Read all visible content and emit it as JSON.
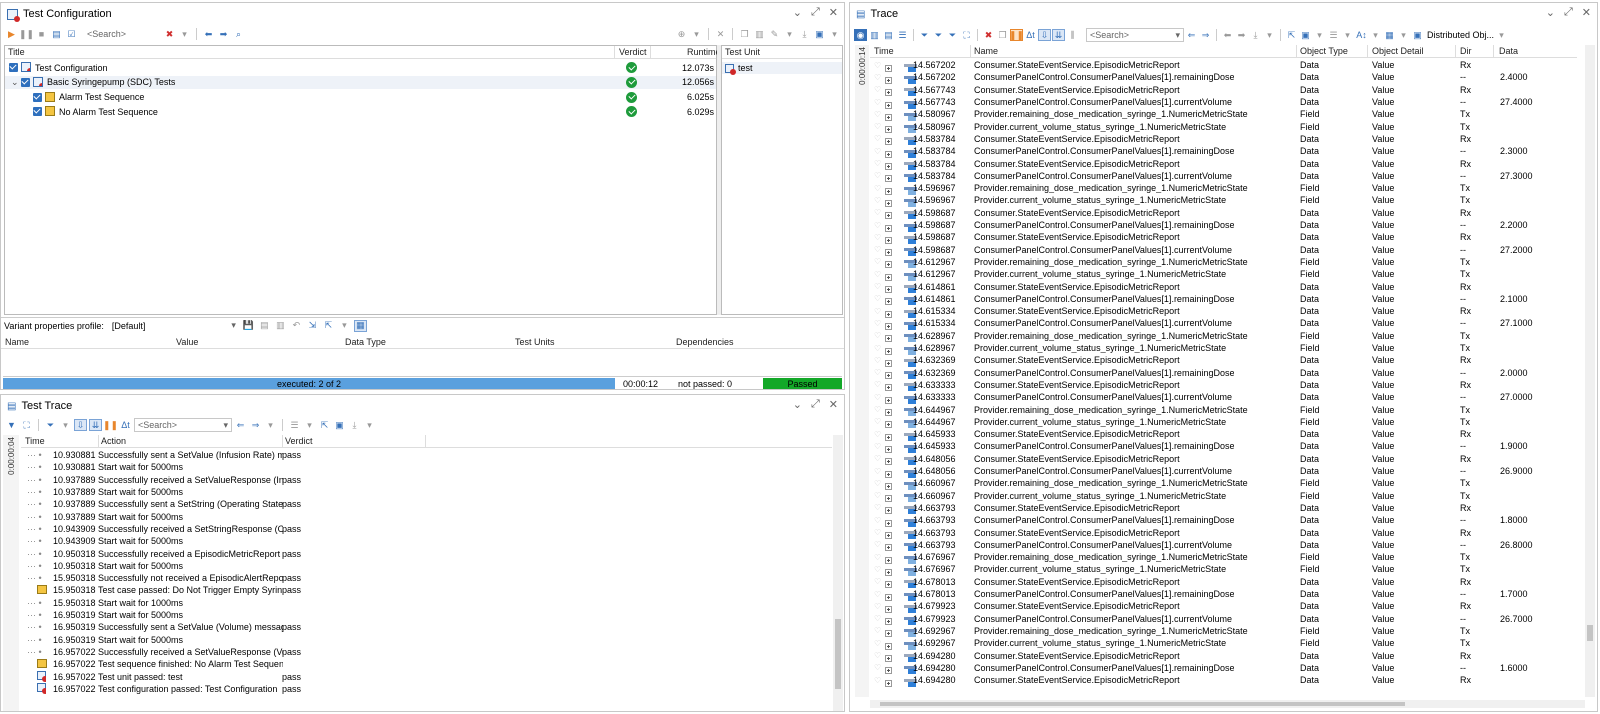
{
  "test_config": {
    "title": "Test Configuration",
    "search_placeholder": "<Search>",
    "columns": {
      "title": "Title",
      "verdict": "Verdict",
      "runtime": "Runtime",
      "test_unit": "Test Unit"
    },
    "rows": [
      {
        "label": "Test Configuration",
        "runtime": "12.073s",
        "level": 0
      },
      {
        "label": "Basic Syringepump (SDC) Tests",
        "runtime": "12.056s",
        "level": 1
      },
      {
        "label": "Alarm Test Sequence",
        "runtime": "6.025s",
        "level": 2
      },
      {
        "label": "No Alarm Test Sequence",
        "runtime": "6.029s",
        "level": 2
      }
    ],
    "test_unit_item": "test",
    "variant_label": "Variant properties profile:",
    "variant_value": "[Default]",
    "variant_columns": {
      "name": "Name",
      "value": "Value",
      "data_type": "Data Type",
      "test_units": "Test Units",
      "dependencies": "Dependencies"
    },
    "status": {
      "executed": "executed: 2 of 2",
      "elapsed": "00:00:12",
      "not_passed": "not passed: 0",
      "result": "Passed",
      "progress": 1.0
    }
  },
  "test_trace": {
    "title": "Test Trace",
    "search_placeholder": "<Search>",
    "time_gutter": "0:00:00:04",
    "columns": {
      "time": "Time",
      "action": "Action",
      "verdict": "Verdict"
    },
    "rows": [
      {
        "time": "10.930881",
        "action": "Successfully sent a SetValue (Infusion Rate) m...",
        "verdict": "pass"
      },
      {
        "time": "10.930881",
        "action": "Start wait for 5000ms",
        "verdict": ""
      },
      {
        "time": "10.937889",
        "action": "Successfully received a SetValueResponse (Inf...",
        "verdict": "pass"
      },
      {
        "time": "10.937889",
        "action": "Start wait for 5000ms",
        "verdict": ""
      },
      {
        "time": "10.937889",
        "action": "Successfully sent a SetString (Operating State)...",
        "verdict": "pass"
      },
      {
        "time": "10.937889",
        "action": "Start wait for 5000ms",
        "verdict": ""
      },
      {
        "time": "10.943909",
        "action": "Successfully received a SetStringResponse (Op...",
        "verdict": "pass"
      },
      {
        "time": "10.943909",
        "action": "Start wait for 5000ms",
        "verdict": ""
      },
      {
        "time": "10.950318",
        "action": "Successfully received a EpisodicMetricReport ...",
        "verdict": "pass"
      },
      {
        "time": "10.950318",
        "action": "Start wait for 5000ms",
        "verdict": ""
      },
      {
        "time": "15.950318",
        "action": "Successfully not received a EpisodicAlertRepor...",
        "verdict": "pass"
      },
      {
        "time": "15.950318",
        "action": "Test case passed: Do Not Trigger Empty Syrin...",
        "verdict": "pass"
      },
      {
        "time": "15.950318",
        "action": "Start wait for 1000ms",
        "verdict": ""
      },
      {
        "time": "16.950319",
        "action": "Start wait for 5000ms",
        "verdict": ""
      },
      {
        "time": "16.950319",
        "action": "Successfully sent a SetValue (Volume) messag...",
        "verdict": "pass"
      },
      {
        "time": "16.950319",
        "action": "Start wait for 5000ms",
        "verdict": ""
      },
      {
        "time": "16.957022",
        "action": "Successfully received a SetValueResponse (Vol...",
        "verdict": "pass"
      },
      {
        "time": "16.957022",
        "action": "Test sequence finished: No Alarm Test Sequence",
        "verdict": ""
      },
      {
        "time": "16.957022",
        "action": "Test unit passed: test",
        "verdict": "pass"
      },
      {
        "time": "16.957022",
        "action": "Test configuration passed: Test Configuration",
        "verdict": "pass"
      }
    ]
  },
  "trace": {
    "title": "Trace",
    "search_placeholder": "<Search>",
    "distributed_label": "Distributed Obj...",
    "time_gutter": "0:00:00:14",
    "columns": {
      "time": "Time",
      "name": "Name",
      "object_type": "Object Type",
      "object_detail": "Object Detail",
      "dir": "Dir",
      "data": "Data"
    },
    "rows": [
      {
        "time": "14.567202",
        "name": "Consumer.StateEventService.EpisodicMetricReport",
        "type": "Data",
        "detail": "Value",
        "dir": "Rx",
        "data": "",
        "kind": "data"
      },
      {
        "time": "14.567202",
        "name": "ConsumerPanelControl.ConsumerPanelValues[1].remainingDose",
        "type": "Data",
        "detail": "Value",
        "dir": "--",
        "data": "2.4000",
        "kind": "val"
      },
      {
        "time": "14.567743",
        "name": "Consumer.StateEventService.EpisodicMetricReport",
        "type": "Data",
        "detail": "Value",
        "dir": "Rx",
        "data": "",
        "kind": "data"
      },
      {
        "time": "14.567743",
        "name": "ConsumerPanelControl.ConsumerPanelValues[1].currentVolume",
        "type": "Data",
        "detail": "Value",
        "dir": "--",
        "data": "27.4000",
        "kind": "val"
      },
      {
        "time": "14.580967",
        "name": "Provider.remaining_dose_medication_syringe_1.NumericMetricState",
        "type": "Field",
        "detail": "Value",
        "dir": "Tx",
        "data": "",
        "kind": "field"
      },
      {
        "time": "14.580967",
        "name": "Provider.current_volume_status_syringe_1.NumericMetricState",
        "type": "Field",
        "detail": "Value",
        "dir": "Tx",
        "data": "",
        "kind": "field"
      },
      {
        "time": "14.583784",
        "name": "Consumer.StateEventService.EpisodicMetricReport",
        "type": "Data",
        "detail": "Value",
        "dir": "Rx",
        "data": "",
        "kind": "data"
      },
      {
        "time": "14.583784",
        "name": "ConsumerPanelControl.ConsumerPanelValues[1].remainingDose",
        "type": "Data",
        "detail": "Value",
        "dir": "--",
        "data": "2.3000",
        "kind": "val"
      },
      {
        "time": "14.583784",
        "name": "Consumer.StateEventService.EpisodicMetricReport",
        "type": "Data",
        "detail": "Value",
        "dir": "Rx",
        "data": "",
        "kind": "data"
      },
      {
        "time": "14.583784",
        "name": "ConsumerPanelControl.ConsumerPanelValues[1].currentVolume",
        "type": "Data",
        "detail": "Value",
        "dir": "--",
        "data": "27.3000",
        "kind": "val"
      },
      {
        "time": "14.596967",
        "name": "Provider.remaining_dose_medication_syringe_1.NumericMetricState",
        "type": "Field",
        "detail": "Value",
        "dir": "Tx",
        "data": "",
        "kind": "field"
      },
      {
        "time": "14.596967",
        "name": "Provider.current_volume_status_syringe_1.NumericMetricState",
        "type": "Field",
        "detail": "Value",
        "dir": "Tx",
        "data": "",
        "kind": "field"
      },
      {
        "time": "14.598687",
        "name": "Consumer.StateEventService.EpisodicMetricReport",
        "type": "Data",
        "detail": "Value",
        "dir": "Rx",
        "data": "",
        "kind": "data"
      },
      {
        "time": "14.598687",
        "name": "ConsumerPanelControl.ConsumerPanelValues[1].remainingDose",
        "type": "Data",
        "detail": "Value",
        "dir": "--",
        "data": "2.2000",
        "kind": "val"
      },
      {
        "time": "14.598687",
        "name": "Consumer.StateEventService.EpisodicMetricReport",
        "type": "Data",
        "detail": "Value",
        "dir": "Rx",
        "data": "",
        "kind": "data"
      },
      {
        "time": "14.598687",
        "name": "ConsumerPanelControl.ConsumerPanelValues[1].currentVolume",
        "type": "Data",
        "detail": "Value",
        "dir": "--",
        "data": "27.2000",
        "kind": "val"
      },
      {
        "time": "14.612967",
        "name": "Provider.remaining_dose_medication_syringe_1.NumericMetricState",
        "type": "Field",
        "detail": "Value",
        "dir": "Tx",
        "data": "",
        "kind": "field"
      },
      {
        "time": "14.612967",
        "name": "Provider.current_volume_status_syringe_1.NumericMetricState",
        "type": "Field",
        "detail": "Value",
        "dir": "Tx",
        "data": "",
        "kind": "field"
      },
      {
        "time": "14.614861",
        "name": "Consumer.StateEventService.EpisodicMetricReport",
        "type": "Data",
        "detail": "Value",
        "dir": "Rx",
        "data": "",
        "kind": "data"
      },
      {
        "time": "14.614861",
        "name": "ConsumerPanelControl.ConsumerPanelValues[1].remainingDose",
        "type": "Data",
        "detail": "Value",
        "dir": "--",
        "data": "2.1000",
        "kind": "val"
      },
      {
        "time": "14.615334",
        "name": "Consumer.StateEventService.EpisodicMetricReport",
        "type": "Data",
        "detail": "Value",
        "dir": "Rx",
        "data": "",
        "kind": "data"
      },
      {
        "time": "14.615334",
        "name": "ConsumerPanelControl.ConsumerPanelValues[1].currentVolume",
        "type": "Data",
        "detail": "Value",
        "dir": "--",
        "data": "27.1000",
        "kind": "val"
      },
      {
        "time": "14.628967",
        "name": "Provider.remaining_dose_medication_syringe_1.NumericMetricState",
        "type": "Field",
        "detail": "Value",
        "dir": "Tx",
        "data": "",
        "kind": "field"
      },
      {
        "time": "14.628967",
        "name": "Provider.current_volume_status_syringe_1.NumericMetricState",
        "type": "Field",
        "detail": "Value",
        "dir": "Tx",
        "data": "",
        "kind": "field"
      },
      {
        "time": "14.632369",
        "name": "Consumer.StateEventService.EpisodicMetricReport",
        "type": "Data",
        "detail": "Value",
        "dir": "Rx",
        "data": "",
        "kind": "data"
      },
      {
        "time": "14.632369",
        "name": "ConsumerPanelControl.ConsumerPanelValues[1].remainingDose",
        "type": "Data",
        "detail": "Value",
        "dir": "--",
        "data": "2.0000",
        "kind": "val"
      },
      {
        "time": "14.633333",
        "name": "Consumer.StateEventService.EpisodicMetricReport",
        "type": "Data",
        "detail": "Value",
        "dir": "Rx",
        "data": "",
        "kind": "data"
      },
      {
        "time": "14.633333",
        "name": "ConsumerPanelControl.ConsumerPanelValues[1].currentVolume",
        "type": "Data",
        "detail": "Value",
        "dir": "--",
        "data": "27.0000",
        "kind": "val"
      },
      {
        "time": "14.644967",
        "name": "Provider.remaining_dose_medication_syringe_1.NumericMetricState",
        "type": "Field",
        "detail": "Value",
        "dir": "Tx",
        "data": "",
        "kind": "field"
      },
      {
        "time": "14.644967",
        "name": "Provider.current_volume_status_syringe_1.NumericMetricState",
        "type": "Field",
        "detail": "Value",
        "dir": "Tx",
        "data": "",
        "kind": "field"
      },
      {
        "time": "14.645933",
        "name": "Consumer.StateEventService.EpisodicMetricReport",
        "type": "Data",
        "detail": "Value",
        "dir": "Rx",
        "data": "",
        "kind": "data"
      },
      {
        "time": "14.645933",
        "name": "ConsumerPanelControl.ConsumerPanelValues[1].remainingDose",
        "type": "Data",
        "detail": "Value",
        "dir": "--",
        "data": "1.9000",
        "kind": "val"
      },
      {
        "time": "14.648056",
        "name": "Consumer.StateEventService.EpisodicMetricReport",
        "type": "Data",
        "detail": "Value",
        "dir": "Rx",
        "data": "",
        "kind": "data"
      },
      {
        "time": "14.648056",
        "name": "ConsumerPanelControl.ConsumerPanelValues[1].currentVolume",
        "type": "Data",
        "detail": "Value",
        "dir": "--",
        "data": "26.9000",
        "kind": "val"
      },
      {
        "time": "14.660967",
        "name": "Provider.remaining_dose_medication_syringe_1.NumericMetricState",
        "type": "Field",
        "detail": "Value",
        "dir": "Tx",
        "data": "",
        "kind": "field"
      },
      {
        "time": "14.660967",
        "name": "Provider.current_volume_status_syringe_1.NumericMetricState",
        "type": "Field",
        "detail": "Value",
        "dir": "Tx",
        "data": "",
        "kind": "field"
      },
      {
        "time": "14.663793",
        "name": "Consumer.StateEventService.EpisodicMetricReport",
        "type": "Data",
        "detail": "Value",
        "dir": "Rx",
        "data": "",
        "kind": "data"
      },
      {
        "time": "14.663793",
        "name": "ConsumerPanelControl.ConsumerPanelValues[1].remainingDose",
        "type": "Data",
        "detail": "Value",
        "dir": "--",
        "data": "1.8000",
        "kind": "val"
      },
      {
        "time": "14.663793",
        "name": "Consumer.StateEventService.EpisodicMetricReport",
        "type": "Data",
        "detail": "Value",
        "dir": "Rx",
        "data": "",
        "kind": "data"
      },
      {
        "time": "14.663793",
        "name": "ConsumerPanelControl.ConsumerPanelValues[1].currentVolume",
        "type": "Data",
        "detail": "Value",
        "dir": "--",
        "data": "26.8000",
        "kind": "val"
      },
      {
        "time": "14.676967",
        "name": "Provider.remaining_dose_medication_syringe_1.NumericMetricState",
        "type": "Field",
        "detail": "Value",
        "dir": "Tx",
        "data": "",
        "kind": "field"
      },
      {
        "time": "14.676967",
        "name": "Provider.current_volume_status_syringe_1.NumericMetricState",
        "type": "Field",
        "detail": "Value",
        "dir": "Tx",
        "data": "",
        "kind": "field"
      },
      {
        "time": "14.678013",
        "name": "Consumer.StateEventService.EpisodicMetricReport",
        "type": "Data",
        "detail": "Value",
        "dir": "Rx",
        "data": "",
        "kind": "data"
      },
      {
        "time": "14.678013",
        "name": "ConsumerPanelControl.ConsumerPanelValues[1].remainingDose",
        "type": "Data",
        "detail": "Value",
        "dir": "--",
        "data": "1.7000",
        "kind": "val"
      },
      {
        "time": "14.679923",
        "name": "Consumer.StateEventService.EpisodicMetricReport",
        "type": "Data",
        "detail": "Value",
        "dir": "Rx",
        "data": "",
        "kind": "data"
      },
      {
        "time": "14.679923",
        "name": "ConsumerPanelControl.ConsumerPanelValues[1].currentVolume",
        "type": "Data",
        "detail": "Value",
        "dir": "--",
        "data": "26.7000",
        "kind": "val"
      },
      {
        "time": "14.692967",
        "name": "Provider.remaining_dose_medication_syringe_1.NumericMetricState",
        "type": "Field",
        "detail": "Value",
        "dir": "Tx",
        "data": "",
        "kind": "field"
      },
      {
        "time": "14.692967",
        "name": "Provider.current_volume_status_syringe_1.NumericMetricState",
        "type": "Field",
        "detail": "Value",
        "dir": "Tx",
        "data": "",
        "kind": "field"
      },
      {
        "time": "14.694280",
        "name": "Consumer.StateEventService.EpisodicMetricReport",
        "type": "Data",
        "detail": "Value",
        "dir": "Rx",
        "data": "",
        "kind": "data"
      },
      {
        "time": "14.694280",
        "name": "ConsumerPanelControl.ConsumerPanelValues[1].remainingDose",
        "type": "Data",
        "detail": "Value",
        "dir": "--",
        "data": "1.6000",
        "kind": "val"
      },
      {
        "time": "14.694280",
        "name": "Consumer.StateEventService.EpisodicMetricReport",
        "type": "Data",
        "detail": "Value",
        "dir": "Rx",
        "data": "",
        "kind": "data"
      }
    ]
  },
  "colors": {
    "accent": "#3570b8",
    "pass_green": "#1e9b3b",
    "progress_blue": "#5aa0de",
    "passed_bar": "#13a828",
    "fail_red": "#d03030"
  }
}
